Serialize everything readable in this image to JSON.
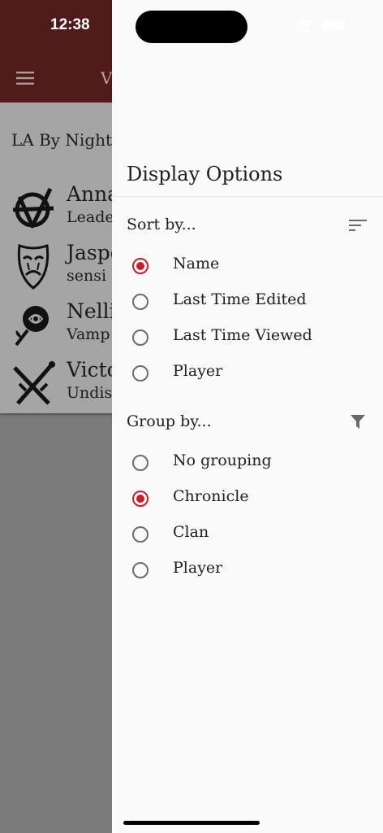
{
  "status_bar": {
    "time": "12:38"
  },
  "app_bar": {
    "title_fragment": "V"
  },
  "list": {
    "section_title": "LA By Night",
    "characters": [
      {
        "name": "Anna",
        "subtitle": "Leade",
        "icon": "anarch-symbol-icon"
      },
      {
        "name": "Jaspe",
        "subtitle": "sensi",
        "icon": "tragedy-mask-icon"
      },
      {
        "name": "Nelli",
        "subtitle": "Vamp",
        "icon": "rose-icon"
      },
      {
        "name": "Victo",
        "subtitle": "Undis",
        "icon": "crossed-swords-icon"
      }
    ]
  },
  "drawer": {
    "title": "Display Options",
    "sort": {
      "header": "Sort by...",
      "icon": "sort-icon",
      "options": [
        {
          "label": "Name",
          "selected": true
        },
        {
          "label": "Last Time Edited",
          "selected": false
        },
        {
          "label": "Last Time Viewed",
          "selected": false
        },
        {
          "label": "Player",
          "selected": false
        }
      ]
    },
    "group": {
      "header": "Group by...",
      "icon": "filter-icon",
      "options": [
        {
          "label": "No grouping",
          "selected": false
        },
        {
          "label": "Chronicle",
          "selected": true
        },
        {
          "label": "Clan",
          "selected": false
        },
        {
          "label": "Player",
          "selected": false
        }
      ]
    }
  },
  "colors": {
    "accent": "#c4202a",
    "app_bar": "#4f1a1a",
    "drawer_bg": "#fafafa",
    "scrim": "#7b7b7b"
  }
}
